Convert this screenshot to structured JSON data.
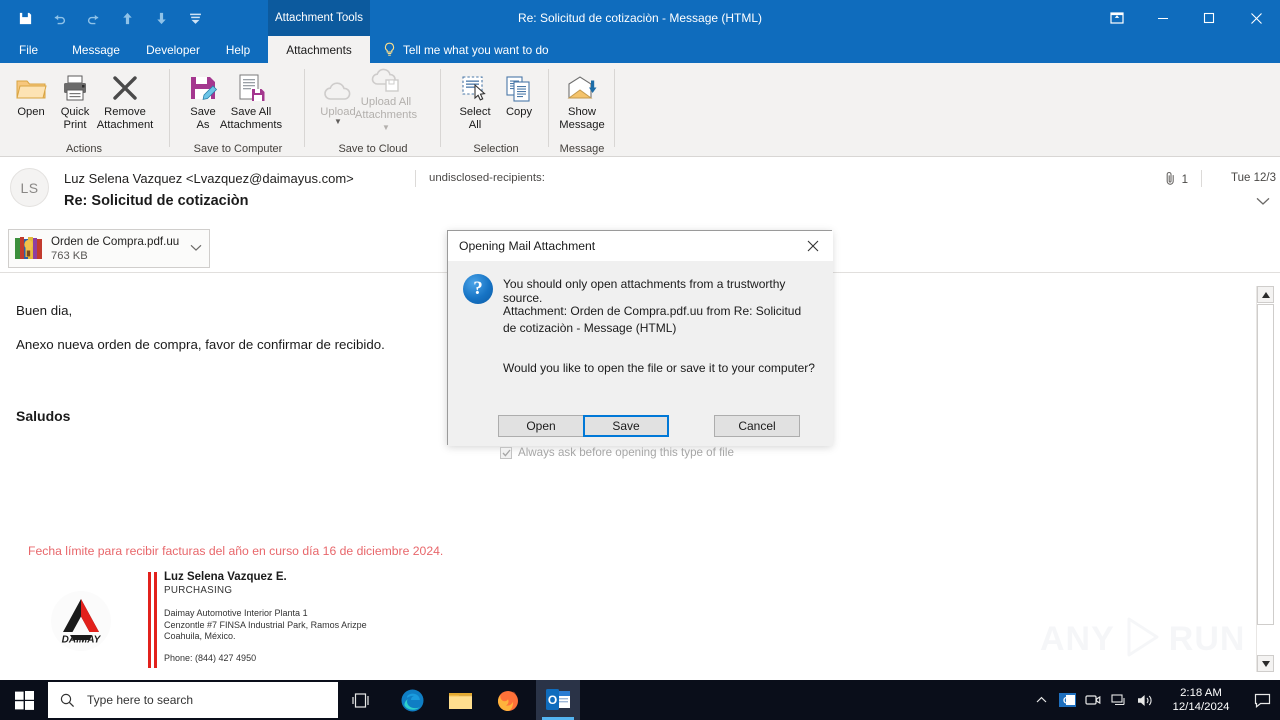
{
  "window": {
    "contextual_tab_group": "Attachment Tools",
    "title": "Re: Solicitud de cotizaciòn  -  Message (HTML)",
    "qat": [
      {
        "name": "save-icon",
        "label": "Save"
      },
      {
        "name": "undo-icon",
        "label": "Undo"
      },
      {
        "name": "redo-icon",
        "label": "Redo"
      },
      {
        "name": "previous-item-icon",
        "label": "Previous Item"
      },
      {
        "name": "next-item-icon",
        "label": "Next Item"
      },
      {
        "name": "customize-quick-access-toolbar-icon",
        "label": "Customize Quick Access Toolbar"
      }
    ],
    "controls": [
      {
        "name": "ribbon-display-options-button",
        "label": "Ribbon Display Options"
      },
      {
        "name": "minimize-button",
        "label": "Minimize"
      },
      {
        "name": "maximize-button",
        "label": "Restore Down"
      },
      {
        "name": "close-button",
        "label": "Close"
      }
    ]
  },
  "tabs": [
    {
      "label": "File",
      "active": false
    },
    {
      "label": "Message",
      "active": false
    },
    {
      "label": "Developer",
      "active": false
    },
    {
      "label": "Help",
      "active": false
    },
    {
      "label": "Attachments",
      "active": true
    }
  ],
  "tellme": {
    "placeholder": "Tell me what you want to do"
  },
  "ribbon": {
    "groups": [
      {
        "label": "Actions",
        "buttons": [
          {
            "label": "Open",
            "icon": "open-folder-icon",
            "disabled": false
          },
          {
            "label": "Quick\nPrint",
            "icon": "printer-icon",
            "disabled": false
          },
          {
            "label": "Remove\nAttachment",
            "icon": "x-mark-icon",
            "disabled": false
          }
        ]
      },
      {
        "label": "Save to Computer",
        "buttons": [
          {
            "label": "Save\nAs",
            "icon": "save-as-icon",
            "disabled": false
          },
          {
            "label": "Save All\nAttachments",
            "icon": "save-all-icon",
            "disabled": false
          }
        ]
      },
      {
        "label": "Save to Cloud",
        "buttons": [
          {
            "label": "Upload",
            "icon": "cloud-upload-icon",
            "disabled": true
          },
          {
            "label": "Upload All\nAttachments",
            "icon": "cloud-upload-all-icon",
            "disabled": true
          }
        ]
      },
      {
        "label": "Selection",
        "buttons": [
          {
            "label": "Select\nAll",
            "icon": "select-all-icon",
            "disabled": false
          },
          {
            "label": "Copy",
            "icon": "copy-icon",
            "disabled": false
          }
        ]
      },
      {
        "label": "Message",
        "buttons": [
          {
            "label": "Show\nMessage",
            "icon": "show-message-icon",
            "disabled": false
          }
        ]
      }
    ]
  },
  "message": {
    "avatar_initials": "LS",
    "from": "Luz Selena Vazquez <Lvazquez@daimayus.com>",
    "recipients": "undisclosed-recipients:",
    "subject": "Re: Solicitud de cotizaciòn",
    "attachment_count": "1",
    "date": "Tue 12/3",
    "attachment": {
      "filename": "Orden de Compra.pdf.uu",
      "size": "763 KB",
      "icon": "winrar-archive-icon"
    },
    "body": {
      "greeting": "Buen dia,",
      "paragraph": "Anexo nueva orden de compra, favor de confirmar de recibido.",
      "closing": "Saludos",
      "notice": "Fecha límite para recibir facturas del año en curso día 16 de diciembre 2024."
    },
    "signature": {
      "logo_text": "DAIMAY",
      "name": "Luz Selena Vazquez E.",
      "role": "PURCHASING",
      "address_line1": "Daimay Automotive Interior Planta 1",
      "address_line2": "Cenzontle #7 FINSA Industrial Park, Ramos Arizpe",
      "address_line3": "Coahuila, México.",
      "phone": "Phone: (844) 427 4950"
    }
  },
  "watermark": {
    "left": "ANY",
    "right": "RUN"
  },
  "dialog": {
    "title": "Opening Mail Attachment",
    "close_label": "Close",
    "warning": "You should only open attachments from a trustworthy source.",
    "attachment_line": "Attachment: Orden de Compra.pdf.uu from Re: Solicitud de cotizaciòn - Message (HTML)",
    "question": "Would you like to open the file or save it to your computer?",
    "buttons": {
      "open": "Open",
      "save": "Save",
      "cancel": "Cancel"
    },
    "checkbox": {
      "label": "Always ask before opening this type of file",
      "checked": true,
      "disabled": true
    },
    "focus_color": "#0078D7"
  },
  "taskbar": {
    "start_label": "Start",
    "search_placeholder": "Type here to search",
    "apps": [
      {
        "name": "task-view-icon",
        "label": "Task View",
        "active": false
      },
      {
        "name": "microsoft-edge-icon",
        "label": "Microsoft Edge",
        "active": false
      },
      {
        "name": "file-explorer-icon",
        "label": "File Explorer",
        "active": false
      },
      {
        "name": "mozilla-firefox-icon",
        "label": "Mozilla Firefox",
        "active": false
      },
      {
        "name": "microsoft-outlook-icon",
        "label": "Microsoft Outlook",
        "active": true
      }
    ],
    "tray": [
      {
        "name": "show-hidden-icons-icon",
        "label": "Show hidden icons"
      },
      {
        "name": "outlook-tray-icon",
        "label": "Outlook"
      },
      {
        "name": "camera-tray-icon",
        "label": "Camera"
      },
      {
        "name": "network-icon",
        "label": "Network"
      },
      {
        "name": "volume-icon",
        "label": "Volume"
      }
    ],
    "clock": {
      "time": "2:18 AM",
      "date": "12/14/2024"
    },
    "action_center": "Notifications"
  },
  "colors": {
    "outlook_blue": "#0F6CBD",
    "ribbon_bg": "#F3F2F1",
    "accent_focus": "#0078D7",
    "notice_red": "#e8676b",
    "signature_red": "#E2211C",
    "taskbar_bg": "#0A0E1A"
  }
}
